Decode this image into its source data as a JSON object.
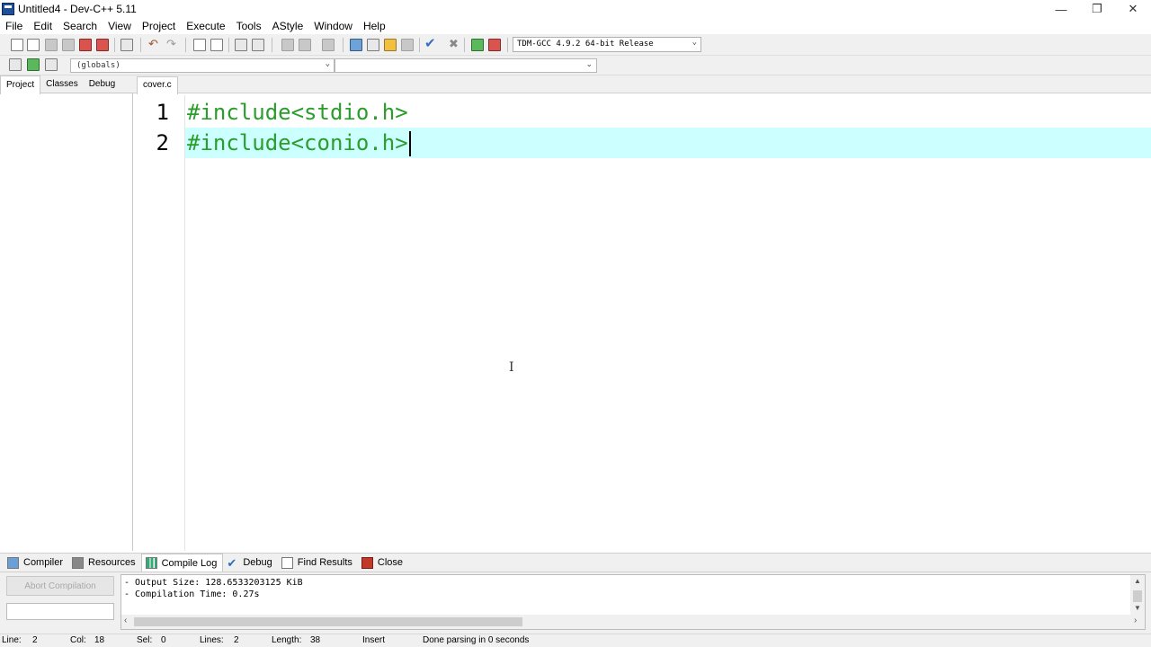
{
  "window": {
    "title": "Untitled4 - Dev-C++ 5.11",
    "minimize_glyph": "—",
    "restore_glyph": "❐",
    "close_glyph": "✕"
  },
  "menu": [
    "File",
    "Edit",
    "Search",
    "View",
    "Project",
    "Execute",
    "Tools",
    "AStyle",
    "Window",
    "Help"
  ],
  "toolbar": {
    "compiler_select": "TDM-GCC 4.9.2 64-bit Release",
    "globals_select": "(globals)",
    "function_select": ""
  },
  "left_panel": {
    "tabs": [
      "Project",
      "Classes",
      "Debug"
    ],
    "active_tab": "Project"
  },
  "editor": {
    "file_tab": "cover.c",
    "lines": [
      {
        "number": "1",
        "code": "#include<stdio.h>"
      },
      {
        "number": "2",
        "code": "#include<conio.h>"
      }
    ],
    "current_line": 2,
    "colors": {
      "code": "#2a9d2a",
      "current_line_bg": "#ccffff"
    }
  },
  "bottom_tabs": [
    {
      "label": "Compiler",
      "icon": "grid-icon"
    },
    {
      "label": "Resources",
      "icon": "resources-icon"
    },
    {
      "label": "Compile Log",
      "icon": "chart-icon"
    },
    {
      "label": "Debug",
      "icon": "check-icon"
    },
    {
      "label": "Find Results",
      "icon": "find-icon"
    },
    {
      "label": "Close",
      "icon": "close-icon"
    }
  ],
  "active_bottom_tab": "Compile Log",
  "compile_panel": {
    "abort_button": "Abort Compilation",
    "log": [
      "- Output Size: 128.6533203125 KiB",
      "- Compilation Time: 0.27s"
    ]
  },
  "statusbar": {
    "line_label": "Line:",
    "line_value": "2",
    "col_label": "Col:",
    "col_value": "18",
    "sel_label": "Sel:",
    "sel_value": "0",
    "lines_label": "Lines:",
    "lines_value": "2",
    "length_label": "Length:",
    "length_value": "38",
    "mode": "Insert",
    "message": "Done parsing in 0 seconds"
  }
}
